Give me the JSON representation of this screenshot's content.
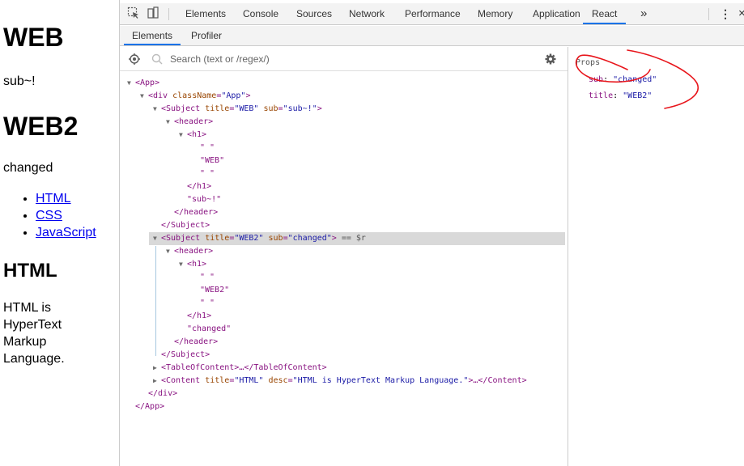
{
  "page": {
    "heading1": "WEB",
    "sub1": "sub~!",
    "heading2": "WEB2",
    "sub2": "changed",
    "links": [
      "HTML",
      "CSS",
      "JavaScript"
    ],
    "heading3": "HTML",
    "desc": "HTML is HyperText Markup Language."
  },
  "devtools": {
    "tabs": [
      "Elements",
      "Console",
      "Sources",
      "Network",
      "Performance",
      "Memory",
      "Application",
      "React"
    ],
    "active_tab": "React",
    "more_tabs": "»",
    "menu": "⋮",
    "close": "×",
    "subtabs": [
      "Elements",
      "Profiler"
    ],
    "active_subtab": "Elements",
    "search_placeholder": "Search (text or /regex/)"
  },
  "tree": {
    "app_open": "<App>",
    "div_tag": "<div",
    "div_attr_name": "className",
    "div_attr_value": "\"App\"",
    "div_close_bracket": ">",
    "subject1_tag": "<Subject",
    "subject1_title_name": "title",
    "subject1_title_value": "\"WEB\"",
    "subject1_sub_name": "sub",
    "subject1_sub_value": "\"sub~!\"",
    "subject1_close_bracket": ">",
    "header_open": "<header>",
    "h1_open": "<h1>",
    "quote_space_1": "\" \"",
    "web_text": "\"WEB\"",
    "quote_space_2": "\" \"",
    "h1_close": "</h1>",
    "sub_text": "\"sub~!\"",
    "header_close": "</header>",
    "subject_close": "</Subject>",
    "subject2_tag": "<Subject",
    "subject2_title_name": "title",
    "subject2_title_value": "\"WEB2\"",
    "subject2_sub_name": "sub",
    "subject2_sub_value": "\"changed\"",
    "subject2_close_bracket": ">",
    "dollar_r": " == $r",
    "header2_open": "<header>",
    "h1_2_open": "<h1>",
    "quote_space_3": "\" \"",
    "web2_text": "\"WEB2\"",
    "quote_space_4": "\" \"",
    "h1_2_close": "</h1>",
    "changed_text": "\"changed\"",
    "header2_close": "</header>",
    "subject2_close": "</Subject>",
    "toc_line": "<TableOfContent>…</TableOfContent>",
    "content_tag": "<Content",
    "content_title_name": "title",
    "content_title_value": "\"HTML\"",
    "content_desc_name": "desc",
    "content_desc_value": "\"HTML is HyperText Markup Language.\"",
    "content_rest": ">…</Content>",
    "div_close": "</div>",
    "app_close": "</App>"
  },
  "props": {
    "title": "Props",
    "items": [
      {
        "key": "sub",
        "value": "\"changed\""
      },
      {
        "key": "title",
        "value": "\"WEB2\""
      }
    ]
  },
  "colors": {
    "annotation": "#e8151b",
    "active_tab_underline": "#1a73e8",
    "selected_row": "#d9d9d9"
  }
}
